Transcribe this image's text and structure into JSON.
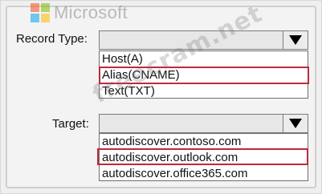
{
  "logo": {
    "icon": "microsoft-logo-icon",
    "text": "Microsoft"
  },
  "record_type": {
    "label": "Record Type:",
    "selected_value": "",
    "options": [
      "Host(A)",
      "Alias(CNAME)",
      "Text(TXT)"
    ],
    "highlighted_option": "Alias(CNAME)"
  },
  "target": {
    "label": "Target:",
    "selected_value": "",
    "options": [
      "autodiscover.contoso.com",
      "autodiscover.outlook.com",
      "autodiscover.office365.com"
    ],
    "highlighted_option": "autodiscover.outlook.com"
  },
  "watermark": "freecram.net",
  "colors": {
    "highlight": "#c0283a"
  }
}
